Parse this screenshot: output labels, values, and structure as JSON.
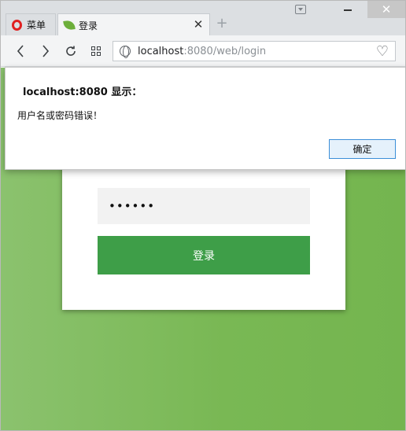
{
  "browser": {
    "menu_label": "菜单",
    "tab_title": "登录",
    "url_host": "localhost",
    "url_rest": ":8080/web/login",
    "icons": {
      "back": "chevron-left",
      "forward": "chevron-right",
      "reload": "reload",
      "speed_dial": "grid",
      "favorite": "heart"
    }
  },
  "login_form": {
    "username_value": "",
    "password_value": "••••••",
    "submit_label": "登录",
    "accent_color": "#3e9e48"
  },
  "dialog": {
    "title": "localhost:8080 显示：",
    "message": "用户名或密码错误！",
    "ok_label": "确定"
  }
}
